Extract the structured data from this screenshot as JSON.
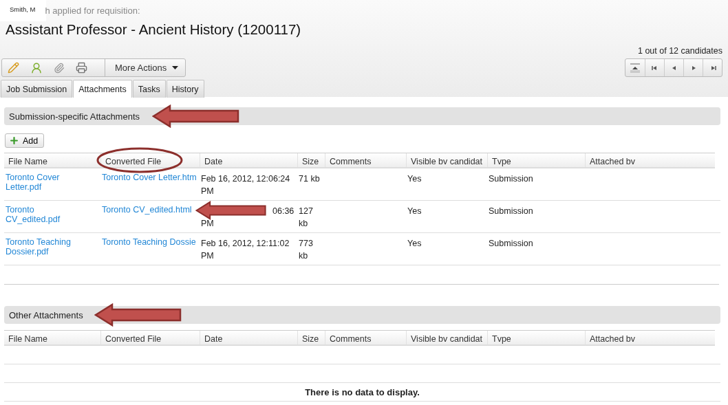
{
  "candidate": {
    "name": "Smith, M",
    "caption": "h applied for requisition:"
  },
  "title": "Assistant Professor - Ancient History (1200117)",
  "toolbar": {
    "more_actions": "More Actions"
  },
  "pager": {
    "count": "1 out of 12 candidates"
  },
  "tabs": [
    {
      "label": "Job Submission",
      "selected": false
    },
    {
      "label": "Attachments",
      "selected": true
    },
    {
      "label": "Tasks",
      "selected": false
    },
    {
      "label": "History",
      "selected": false
    }
  ],
  "sections": [
    {
      "title": "Submission-specific Attachments",
      "arrow": true,
      "add_button": "Add",
      "columns": [
        {
          "label": "File Name",
          "circled": false
        },
        {
          "label": "Converted File",
          "circled": true
        },
        {
          "label": "Date",
          "circled": false
        },
        {
          "label": "Size",
          "circled": false
        },
        {
          "label": "Comments",
          "circled": false
        },
        {
          "label": "Visible bv candidat",
          "circled": false
        },
        {
          "label": "Tvpe",
          "circled": false
        },
        {
          "label": "Attached bv",
          "circled": false
        }
      ],
      "rows": [
        {
          "file_name": "Toronto Cover Letter.pdf",
          "converted_file": "Toronto Cover Letter.htm",
          "date": [
            "Feb 16, 2012, 12:06:24",
            "PM"
          ],
          "size": "71 kb",
          "visible": "Yes",
          "type": "Submission",
          "arrow": false
        },
        {
          "file_name": "Toronto CV_edited.pdf",
          "converted_file": "Toronto CV_edited.html",
          "date": [
            "06:36",
            "PM"
          ],
          "size": "127 kb",
          "visible": "Yes",
          "type": "Submission",
          "arrow": true
        },
        {
          "file_name": "Toronto Teaching Dossier.pdf",
          "converted_file": "Toronto Teaching Dossie",
          "date": [
            "Feb 16, 2012, 12:11:02",
            "PM"
          ],
          "size": "773 kb",
          "visible": "Yes",
          "type": "Submission",
          "arrow": false
        }
      ]
    },
    {
      "title": "Other Attachments",
      "arrow": true,
      "columns": [
        {
          "label": "File Name",
          "circled": false
        },
        {
          "label": "Converted File",
          "circled": false
        },
        {
          "label": "Date",
          "circled": false
        },
        {
          "label": "Size",
          "circled": false
        },
        {
          "label": "Comments",
          "circled": false
        },
        {
          "label": "Visible bv candidat",
          "circled": false
        },
        {
          "label": "Tvpe",
          "circled": false
        },
        {
          "label": "Attached bv",
          "circled": false
        }
      ],
      "empty_message": "There is no data to display."
    }
  ]
}
